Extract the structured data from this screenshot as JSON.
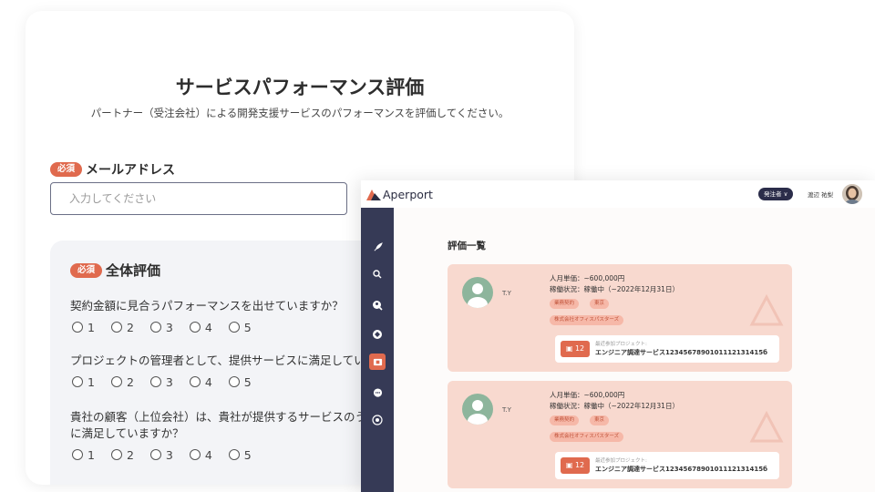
{
  "survey": {
    "title": "サービスパフォーマンス評価",
    "subtitle": "パートナー（受注会社）による開発支援サービスのパフォーマンスを評価してください。",
    "required_badge": "必須",
    "email": {
      "label": "メールアドレス",
      "placeholder": "入力してください"
    },
    "rating": {
      "title": "全体評価",
      "questions": [
        {
          "text": "契約金額に見合うパフォーマンスを出せていますか？",
          "options": [
            "1",
            "2",
            "3",
            "4",
            "5"
          ]
        },
        {
          "text": "プロジェクトの管理者として、提供サービスに満足してい",
          "options": [
            "1",
            "2",
            "3",
            "4",
            "5"
          ]
        },
        {
          "text": "貴社の顧客（上位会社）は、貴社が提供するサービスのう",
          "text2": "に満足していますか？",
          "options": [
            "1",
            "2",
            "3",
            "4",
            "5"
          ]
        }
      ]
    }
  },
  "app": {
    "logo_text": "Aperport",
    "role_pill": "発注者 ∨",
    "user_name": "渡辺 祐梨",
    "list_title": "評価一覧",
    "cards": [
      {
        "initials": "T.Y",
        "unit_price": "人月単価：~600,000円",
        "status": "稼働状況：稼働中（~2022年12月31日）",
        "tag_contract": "業務契約",
        "tag_location": "東京",
        "tag_company": "株式会社オフィスパスターズ",
        "project_label": "最近参加プロジェクト:",
        "project_count": "12",
        "project_name": "エンジニア調達サービス1234567890101112131415б"
      },
      {
        "initials": "T.Y",
        "unit_price": "人月単価：~600,000円",
        "status": "稼働状況：稼働中（~2022年12月31日）",
        "tag_contract": "業務契約",
        "tag_location": "東京",
        "tag_company": "株式会社オフィスパスターズ",
        "project_label": "最近参加プロジェクト:",
        "project_count": "12",
        "project_name": "エンジニア調達サービス1234567890101112131415б"
      }
    ],
    "sidebar_icons": [
      "rocket-icon",
      "search-icon",
      "search-person-icon",
      "globe-icon",
      "evaluation-icon",
      "chat-icon",
      "settings-icon"
    ]
  },
  "colors": {
    "accent": "#e06a4e",
    "sidebar": "#363a56",
    "card_bg": "#f8d9cf",
    "panel_bg": "#f3f4f7"
  }
}
